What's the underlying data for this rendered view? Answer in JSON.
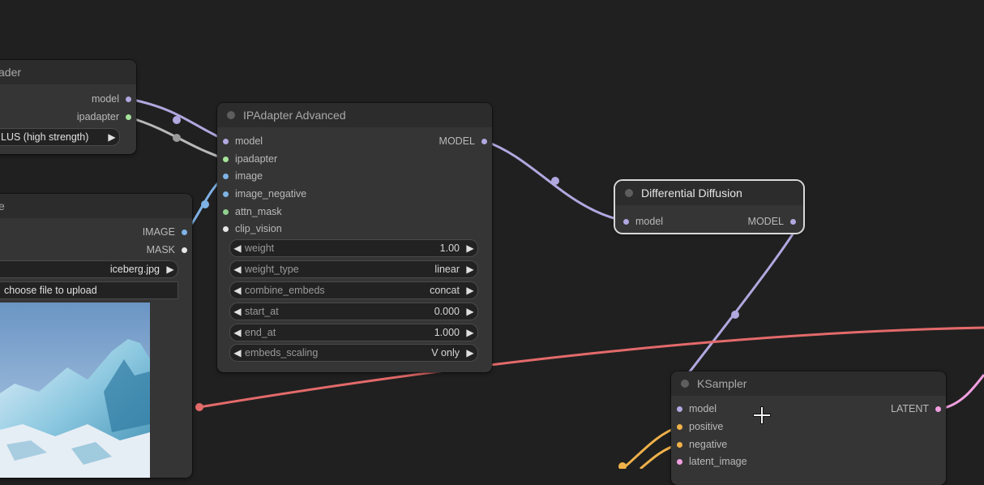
{
  "colors": {
    "canvas": "#202020",
    "node_body": "#353535",
    "node_title": "#2c2c2c",
    "model_port": "#b1a8e0",
    "ipadapter_port": "#a6e39a",
    "image_port": "#7fb3e6",
    "mask_port": "#8fcf8f",
    "clip_vision_port": "#e6e6e6",
    "conditioning_port": "#f0b14a",
    "latent_port": "#f0a0e0",
    "red_wire": "#e46a6a"
  },
  "loader_node": {
    "title": "ader",
    "outputs": [
      "model",
      "ipadapter"
    ],
    "preset_value": "LUS (high strength)"
  },
  "load_image_node": {
    "title": "e",
    "outputs": [
      "IMAGE",
      "MASK"
    ],
    "image_value": "iceberg.jpg",
    "upload_label": "choose file to upload"
  },
  "ipadapter_node": {
    "title": "IPAdapter Advanced",
    "inputs": [
      "model",
      "ipadapter",
      "image",
      "image_negative",
      "attn_mask",
      "clip_vision"
    ],
    "output": "MODEL",
    "widgets": [
      {
        "name": "weight",
        "value": "1.00"
      },
      {
        "name": "weight_type",
        "value": "linear"
      },
      {
        "name": "combine_embeds",
        "value": "concat"
      },
      {
        "name": "start_at",
        "value": "0.000"
      },
      {
        "name": "end_at",
        "value": "1.000"
      },
      {
        "name": "embeds_scaling",
        "value": "V only"
      }
    ]
  },
  "diff_node": {
    "title": "Differential Diffusion",
    "input": "model",
    "output": "MODEL"
  },
  "ksampler_node": {
    "title": "KSampler",
    "inputs": [
      "model",
      "positive",
      "negative",
      "latent_image"
    ],
    "output": "LATENT"
  }
}
